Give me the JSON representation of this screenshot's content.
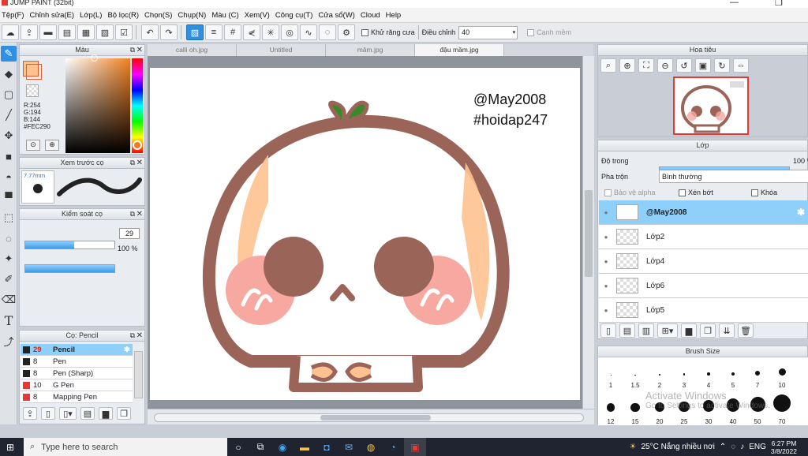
{
  "window": {
    "title": "JUMP PAINT (32bit)"
  },
  "menu": [
    "Tệp(F)",
    "Chỉnh sửa(E)",
    "Lớp(L)",
    "Bộ lọc(R)",
    "Chọn(S)",
    "Chụp(N)",
    "Màu (C)",
    "Xem(V)",
    "Công cụ(T)",
    "Cửa sổ(W)",
    "Cloud",
    "Help"
  ],
  "toolbar": {
    "antialias_label": "Khử răng cưa",
    "adjust_label": "Điều chỉnh",
    "adjust_value": "40",
    "smooth_label": "Cạnh mềm"
  },
  "color_panel": {
    "title": "Màu",
    "r": "R:254",
    "g": "G:194",
    "b": "B:144",
    "hex": "#FEC290",
    "primary_color": "#FEC290"
  },
  "brush_preview": {
    "title": "Xem trước cọ",
    "size": "7.77mm"
  },
  "brush_control": {
    "title": "Kiểm soát cọ",
    "size_value": "29",
    "opacity_value": "100 %",
    "size_fraction": 0.55,
    "opacity_fraction": 1.0
  },
  "brush_list": {
    "title": "Cọ: Pencil",
    "items": [
      {
        "size": "29",
        "name": "Pencil",
        "color": "#222222",
        "selected": true
      },
      {
        "size": "8",
        "name": "Pen",
        "color": "#222222",
        "selected": false
      },
      {
        "size": "8",
        "name": "Pen (Sharp)",
        "color": "#222222",
        "selected": false
      },
      {
        "size": "10",
        "name": "G Pen",
        "color": "#e53935",
        "selected": false
      },
      {
        "size": "8",
        "name": "Mapping Pen",
        "color": "#e53935",
        "selected": false
      }
    ]
  },
  "tabs": [
    "calli oh.jpg",
    "Untitled",
    "mâm.jpg",
    "đậu mầm.jpg"
  ],
  "active_tab": 3,
  "canvas": {
    "text_line1": "@May2008",
    "text_line2": "#hoidap247"
  },
  "navigator": {
    "title": "Hoa tiêu"
  },
  "layers": {
    "title": "Lớp",
    "opacity_label": "Độ trong",
    "opacity_value": "100 %",
    "opacity_fraction": 1.0,
    "blend_label": "Pha trộn",
    "blend_value": "Bình thường",
    "protect_alpha": "Bảo vệ alpha",
    "clipping": "Xén bớt",
    "lock": "Khóa",
    "items": [
      {
        "name": "@May2008",
        "selected": true
      },
      {
        "name": "Lớp2",
        "selected": false
      },
      {
        "name": "Lớp4",
        "selected": false
      },
      {
        "name": "Lớp6",
        "selected": false
      },
      {
        "name": "Lớp5",
        "selected": false
      }
    ]
  },
  "brush_size_panel": {
    "title": "Brush Size",
    "row1": [
      "1",
      "1.5",
      "2",
      "3",
      "4",
      "5",
      "7",
      "10"
    ],
    "row2": [
      "12",
      "15",
      "20",
      "25",
      "30",
      "40",
      "50",
      "70"
    ]
  },
  "watermark": {
    "line1": "Activate Windows",
    "line2": "Go to Settings to activate Windows."
  },
  "taskbar": {
    "search_placeholder": "Type here to search",
    "weather": "25°C  Nắng nhiều nơi",
    "lang": "ENG",
    "time": "6:27 PM",
    "date": "3/8/2022"
  }
}
